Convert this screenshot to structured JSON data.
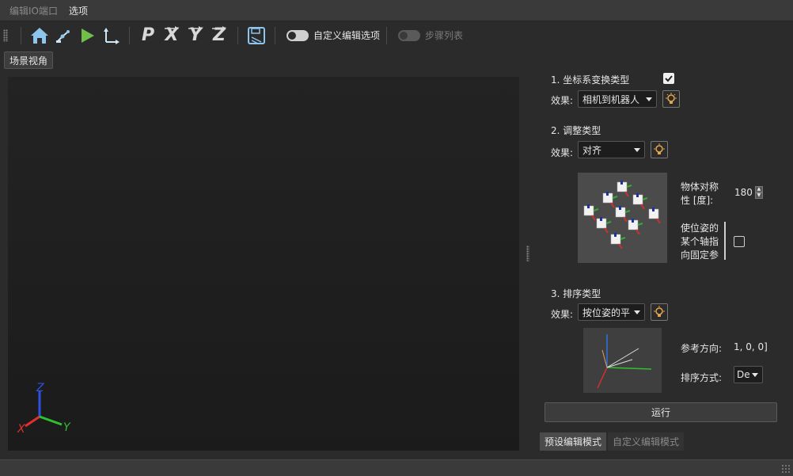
{
  "menu": {
    "items": [
      {
        "label": "编辑IO端口",
        "enabled": false
      },
      {
        "label": "选项",
        "enabled": true
      }
    ]
  },
  "toolbar": {
    "icons": [
      "home-icon",
      "robot-arm-icon",
      "play-icon",
      "axes-icon",
      "p-icon",
      "x-axis-icon",
      "y-axis-icon",
      "z-axis-icon",
      "save-icon"
    ],
    "letters": {
      "p": "P",
      "x": "X",
      "y": "Y",
      "z": "Z"
    },
    "custom_edit_toggle": {
      "label": "自定义编辑选项",
      "on": false
    },
    "steps_list_toggle": {
      "label": "步骤列表",
      "on": false,
      "enabled": false
    }
  },
  "scene": {
    "tab_label": "场景视角",
    "axes": {
      "x": "X",
      "y": "Y",
      "z": "Z"
    }
  },
  "sections": {
    "transform": {
      "title": "1. 坐标系变换类型",
      "checked": true,
      "effect_label": "效果:",
      "effect_value": "相机到机器人"
    },
    "adjust": {
      "title": "2. 调整类型",
      "effect_label": "效果:",
      "effect_value": "对齐",
      "symmetry_label": "物体对称性 [度]:",
      "symmetry_value": "180",
      "axis_label": "使位姿的某个轴指向固定参",
      "axis_checked": false
    },
    "sort": {
      "title": "3. 排序类型",
      "effect_label": "效果:",
      "effect_value": "按位姿的平",
      "ref_dir_label": "参考方向:",
      "ref_dir_value": "1, 0, 0]",
      "sort_mode_label": "排序方式:",
      "sort_mode_value": "De"
    }
  },
  "run_label": "运行",
  "modes": [
    {
      "label": "预设编辑模式",
      "active": true
    },
    {
      "label": "自定义编辑模式",
      "active": false
    }
  ],
  "colors": {
    "accent_green": "#6fbf4a",
    "axis_x": "#e03030",
    "axis_y": "#2fc02f",
    "axis_z": "#3050e0",
    "bulb": "#e8a74a"
  }
}
